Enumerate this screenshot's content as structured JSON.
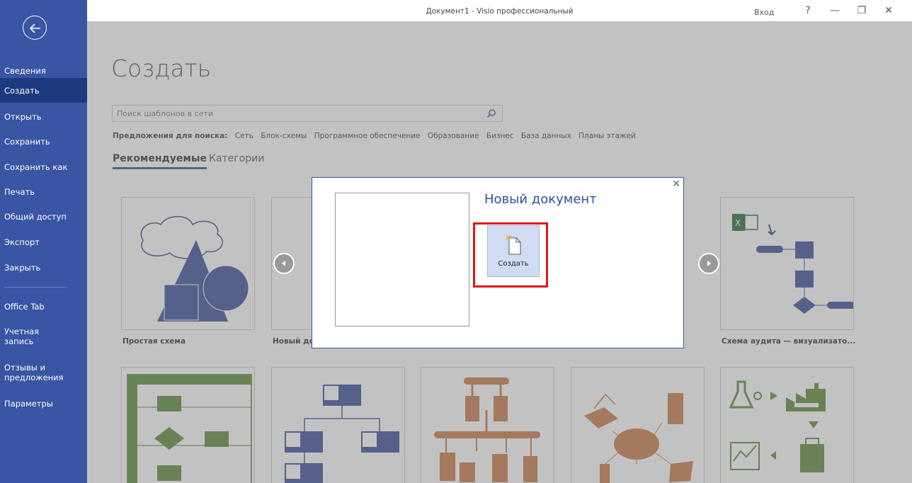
{
  "window": {
    "title": "Документ1  -  Visio профессиональный",
    "signin": "Вход",
    "help": "?",
    "minimize": "—",
    "restore": "❐",
    "close": "✕"
  },
  "sidebar": {
    "items": [
      {
        "label": "Сведения"
      },
      {
        "label": "Создать"
      },
      {
        "label": "Открыть"
      },
      {
        "label": "Сохранить"
      },
      {
        "label": "Сохранить как"
      },
      {
        "label": "Печать"
      },
      {
        "label": "Общий доступ"
      },
      {
        "label": "Экспорт"
      },
      {
        "label": "Закрыть"
      },
      {
        "label": "Office Tab"
      },
      {
        "label": "Учетная запись"
      },
      {
        "label": "Отзывы и предложения"
      },
      {
        "label": "Параметры"
      }
    ]
  },
  "main": {
    "title": "Создать",
    "search_placeholder": "Поиск шаблонов в сети",
    "suggest_label": "Предложения для поиска:",
    "suggestions": [
      "Сеть",
      "Блок-схемы",
      "Программное обеспечение",
      "Образование",
      "Бизнес",
      "База данных",
      "Планы этажей"
    ],
    "tabs": [
      "Рекомендуемые",
      "Категории"
    ],
    "templates": [
      {
        "label": "Простая схема"
      },
      {
        "label": "Новый до"
      },
      {
        "label": "Схема аудита — визуализато..."
      }
    ]
  },
  "dialog": {
    "title": "Новый документ",
    "create_label": "Создать"
  },
  "colors": {
    "sidebar": "#3955a3",
    "sidebar_active": "#1e3a7f",
    "highlight": "#e0161d",
    "accent": "#2e4f9c"
  }
}
